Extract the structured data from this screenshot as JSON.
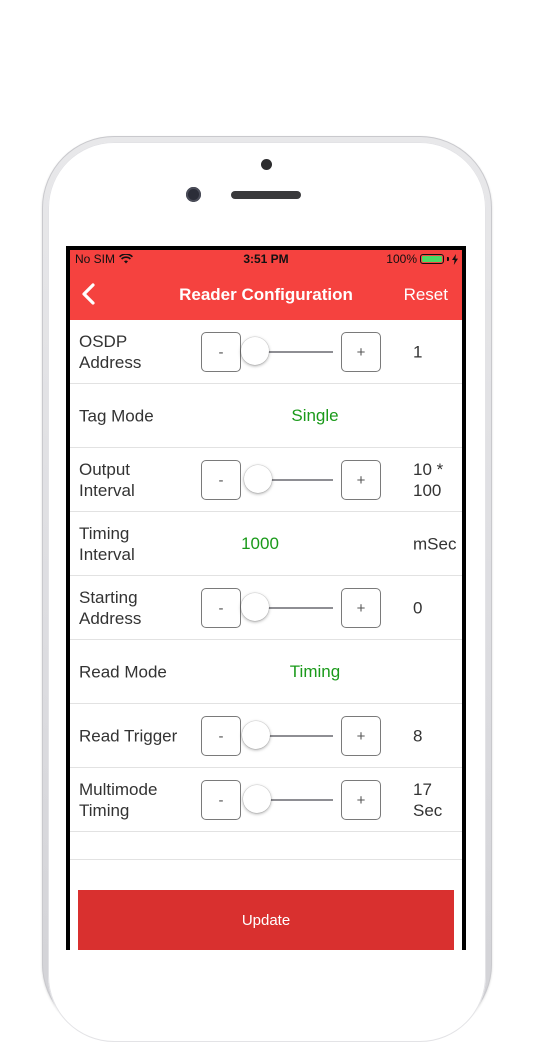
{
  "statusbar": {
    "carrier": "No SIM",
    "time": "3:51 PM",
    "battery": "100%"
  },
  "navbar": {
    "title": "Reader Configuration",
    "reset_label": "Reset",
    "back_icon": "chevron-left-icon"
  },
  "rows": [
    {
      "label": "OSDP\nAddress",
      "type": "stepper",
      "value": "1",
      "slider_fraction": 0.0,
      "minus": "-",
      "plus": "+"
    },
    {
      "label": "Tag Mode",
      "type": "choice",
      "value": "Single"
    },
    {
      "label": "Output\nInterval",
      "type": "stepper",
      "value": "10 *\n100",
      "slider_fraction": 0.05,
      "minus": "-",
      "plus": "+"
    },
    {
      "label": "Timing\nInterval",
      "type": "number",
      "value": "1000",
      "unit": "mSec"
    },
    {
      "label": "Starting\nAddress",
      "type": "stepper",
      "value": "0",
      "slider_fraction": 0.0,
      "minus": "-",
      "plus": "+"
    },
    {
      "label": "Read Mode",
      "type": "choice",
      "value": "Timing"
    },
    {
      "label": "Read Trigger",
      "type": "stepper",
      "value": "8",
      "slider_fraction": 0.02,
      "minus": "-",
      "plus": "+"
    },
    {
      "label": "Multimode\nTiming",
      "type": "stepper",
      "value": "17\nSec",
      "slider_fraction": 0.04,
      "minus": "-",
      "plus": "+"
    }
  ],
  "update_label": "Update",
  "colors": {
    "accent": "#f5423f",
    "button": "#d9302f",
    "value_green": "#1a9a1a",
    "battery_green": "#4cd964"
  }
}
